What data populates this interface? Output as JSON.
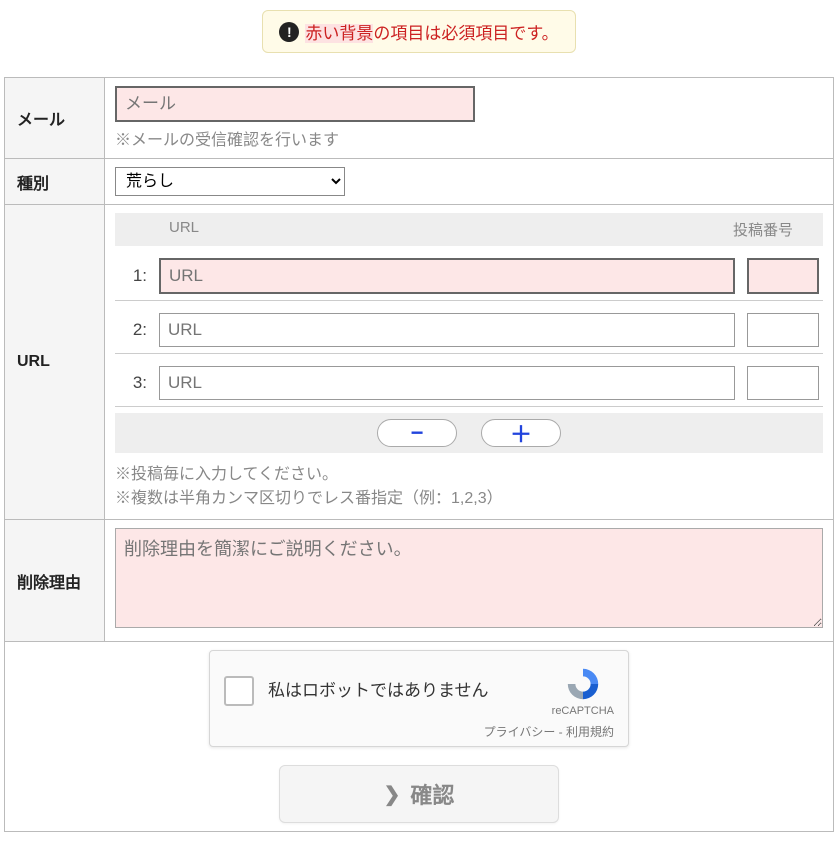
{
  "notice": {
    "prefix": "赤い背景",
    "suffix": "の項目は必須項目です。"
  },
  "labels": {
    "mail": "メール",
    "type": "種別",
    "url": "URL",
    "reason": "削除理由"
  },
  "mail": {
    "placeholder": "メール",
    "hint": "※メールの受信確認を行います"
  },
  "type": {
    "selected": "荒らし"
  },
  "url_section": {
    "head_url": "URL",
    "head_num": "投稿番号",
    "rows": [
      {
        "idx": "1:",
        "placeholder": "URL",
        "required": true
      },
      {
        "idx": "2:",
        "placeholder": "URL",
        "required": false
      },
      {
        "idx": "3:",
        "placeholder": "URL",
        "required": false
      }
    ],
    "minus": "−",
    "plus": "＋",
    "note1": "※投稿毎に入力してください。",
    "note2": "※複数は半角カンマ区切りでレス番指定（例：1,2,3）"
  },
  "reason": {
    "placeholder": "削除理由を簡潔にご説明ください。"
  },
  "recaptcha": {
    "label": "私はロボットではありません",
    "brand": "reCAPTCHA",
    "links": "プライバシー - 利用規約"
  },
  "confirm": {
    "label": "確認"
  }
}
